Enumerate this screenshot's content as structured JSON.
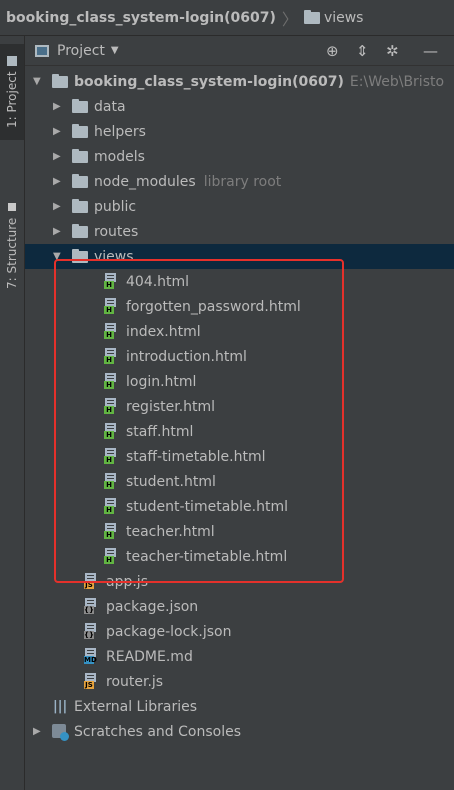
{
  "navbar": {
    "project": "booking_class_system-login(0607)",
    "separator": "〉",
    "folder": "views"
  },
  "side": {
    "project_tab": "1: Project",
    "structure_tab": "7: Structure"
  },
  "toolbar": {
    "label": "Project",
    "icons": [
      "target-icon",
      "collapse-icon",
      "gear-icon",
      "minimize-icon"
    ]
  },
  "tree": {
    "root": {
      "name": "booking_class_system-login(0607)",
      "path": "E:\\Web\\Bristo"
    },
    "folders": [
      {
        "name": "data"
      },
      {
        "name": "helpers"
      },
      {
        "name": "models"
      },
      {
        "name": "node_modules",
        "hint": "library root"
      },
      {
        "name": "public"
      },
      {
        "name": "routes"
      }
    ],
    "views_folder": "views",
    "view_files": [
      "404.html",
      "forgotten_password.html",
      "index.html",
      "introduction.html",
      "login.html",
      "register.html",
      "staff.html",
      "staff-timetable.html",
      "student.html",
      "student-timetable.html",
      "teacher.html",
      "teacher-timetable.html"
    ],
    "root_files": [
      {
        "name": "app.js",
        "tag": "JS",
        "color": "#e6a23c"
      },
      {
        "name": "package.json",
        "tag": "{}",
        "color": "#8a8a8a"
      },
      {
        "name": "package-lock.json",
        "tag": "{}",
        "color": "#8a8a8a"
      },
      {
        "name": "README.md",
        "tag": "MD",
        "color": "#3592c4"
      },
      {
        "name": "router.js",
        "tag": "JS",
        "color": "#e6a23c"
      }
    ],
    "external_libraries": "External Libraries",
    "scratches": "Scratches and Consoles"
  },
  "colors": {
    "background": "#3c3f41",
    "selection": "#0d293e",
    "highlight_box": "#e5312b",
    "html_tag": "#62b543"
  }
}
